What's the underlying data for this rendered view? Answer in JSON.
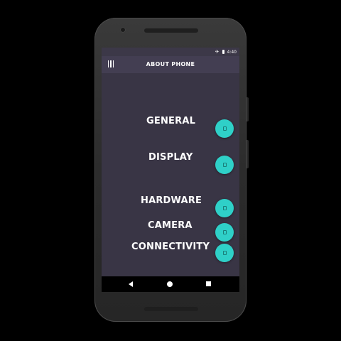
{
  "status_bar": {
    "time": "4:40",
    "signal_icon": "airplane-icon",
    "battery_icon": "battery-icon"
  },
  "app_bar": {
    "title": "ABOUT PHONE",
    "menu_icon": "hamburger-icon"
  },
  "menu": {
    "items": [
      {
        "label": "GENERAL"
      },
      {
        "label": "DISPLAY"
      },
      {
        "label": "HARDWARE"
      },
      {
        "label": "CAMERA"
      },
      {
        "label": "CONNECTIVITY"
      }
    ]
  },
  "colors": {
    "screen_bg": "#393545",
    "app_bar_bg": "#433e52",
    "fab": "#2fd0c8"
  }
}
